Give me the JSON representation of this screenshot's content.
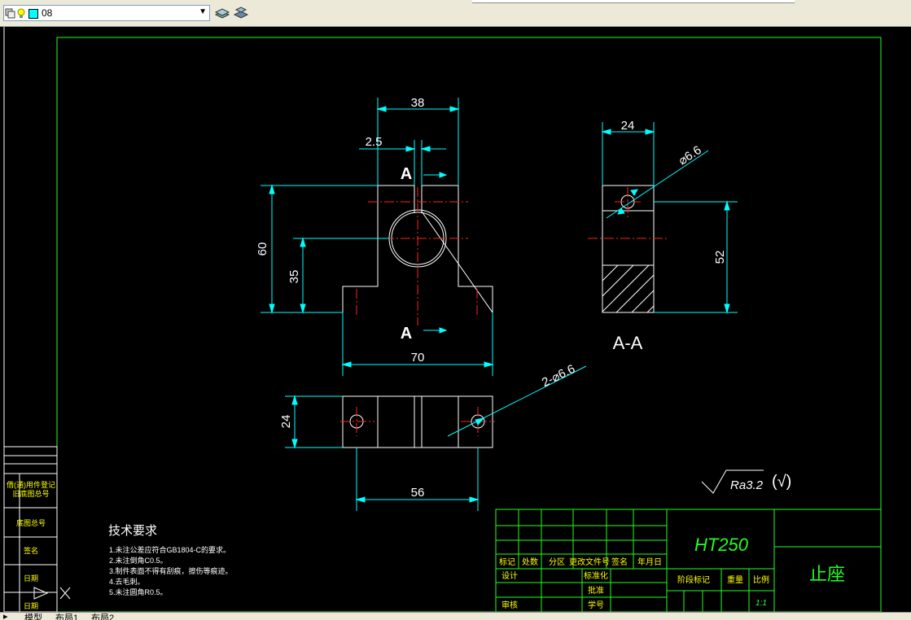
{
  "toolbar": {
    "layer_name": "08",
    "combo_arrow": "▼"
  },
  "drawing": {
    "dims": {
      "top_width": "38",
      "slot": "2.5",
      "height_total": "60",
      "center_height": "35",
      "base_width": "70",
      "side_width": "24",
      "hole_dia": "⌀6.6",
      "side_height": "52",
      "bottom_depth": "24",
      "hole_spacing": "56",
      "holes_note": "2-⌀6.6"
    },
    "section_label": "A",
    "section_view": "A-A",
    "roughness": "Ra3.2",
    "roughness_other": "(√)",
    "tech_req": {
      "title": "技术要求",
      "items": [
        "1.未注公差应符合GB1804-C的要求。",
        "2.未注倒角C0.5。",
        "3.制件表面不得有刮痕，擦伤等痕迹。",
        "4.去毛刺。",
        "5.未注圆角R0.5。"
      ]
    },
    "title_block": {
      "material": "HT250",
      "part_name": "止座",
      "scale": "1:1",
      "headers_row": [
        "标记",
        "处数",
        "分区",
        "更改文件号",
        "签名",
        "年月日"
      ],
      "left_labels": [
        "设计",
        "审核"
      ],
      "mid_labels": [
        "标准化",
        "批准",
        "学号"
      ],
      "stage_labels": [
        "阶段标记",
        "重量",
        "比例"
      ]
    },
    "left_strip": [
      "借(通)用件登记",
      "旧底图总号",
      "底图总号",
      "签名",
      "日期",
      "日期"
    ]
  },
  "tabs": [
    "模型",
    "布局1",
    "布局2"
  ]
}
